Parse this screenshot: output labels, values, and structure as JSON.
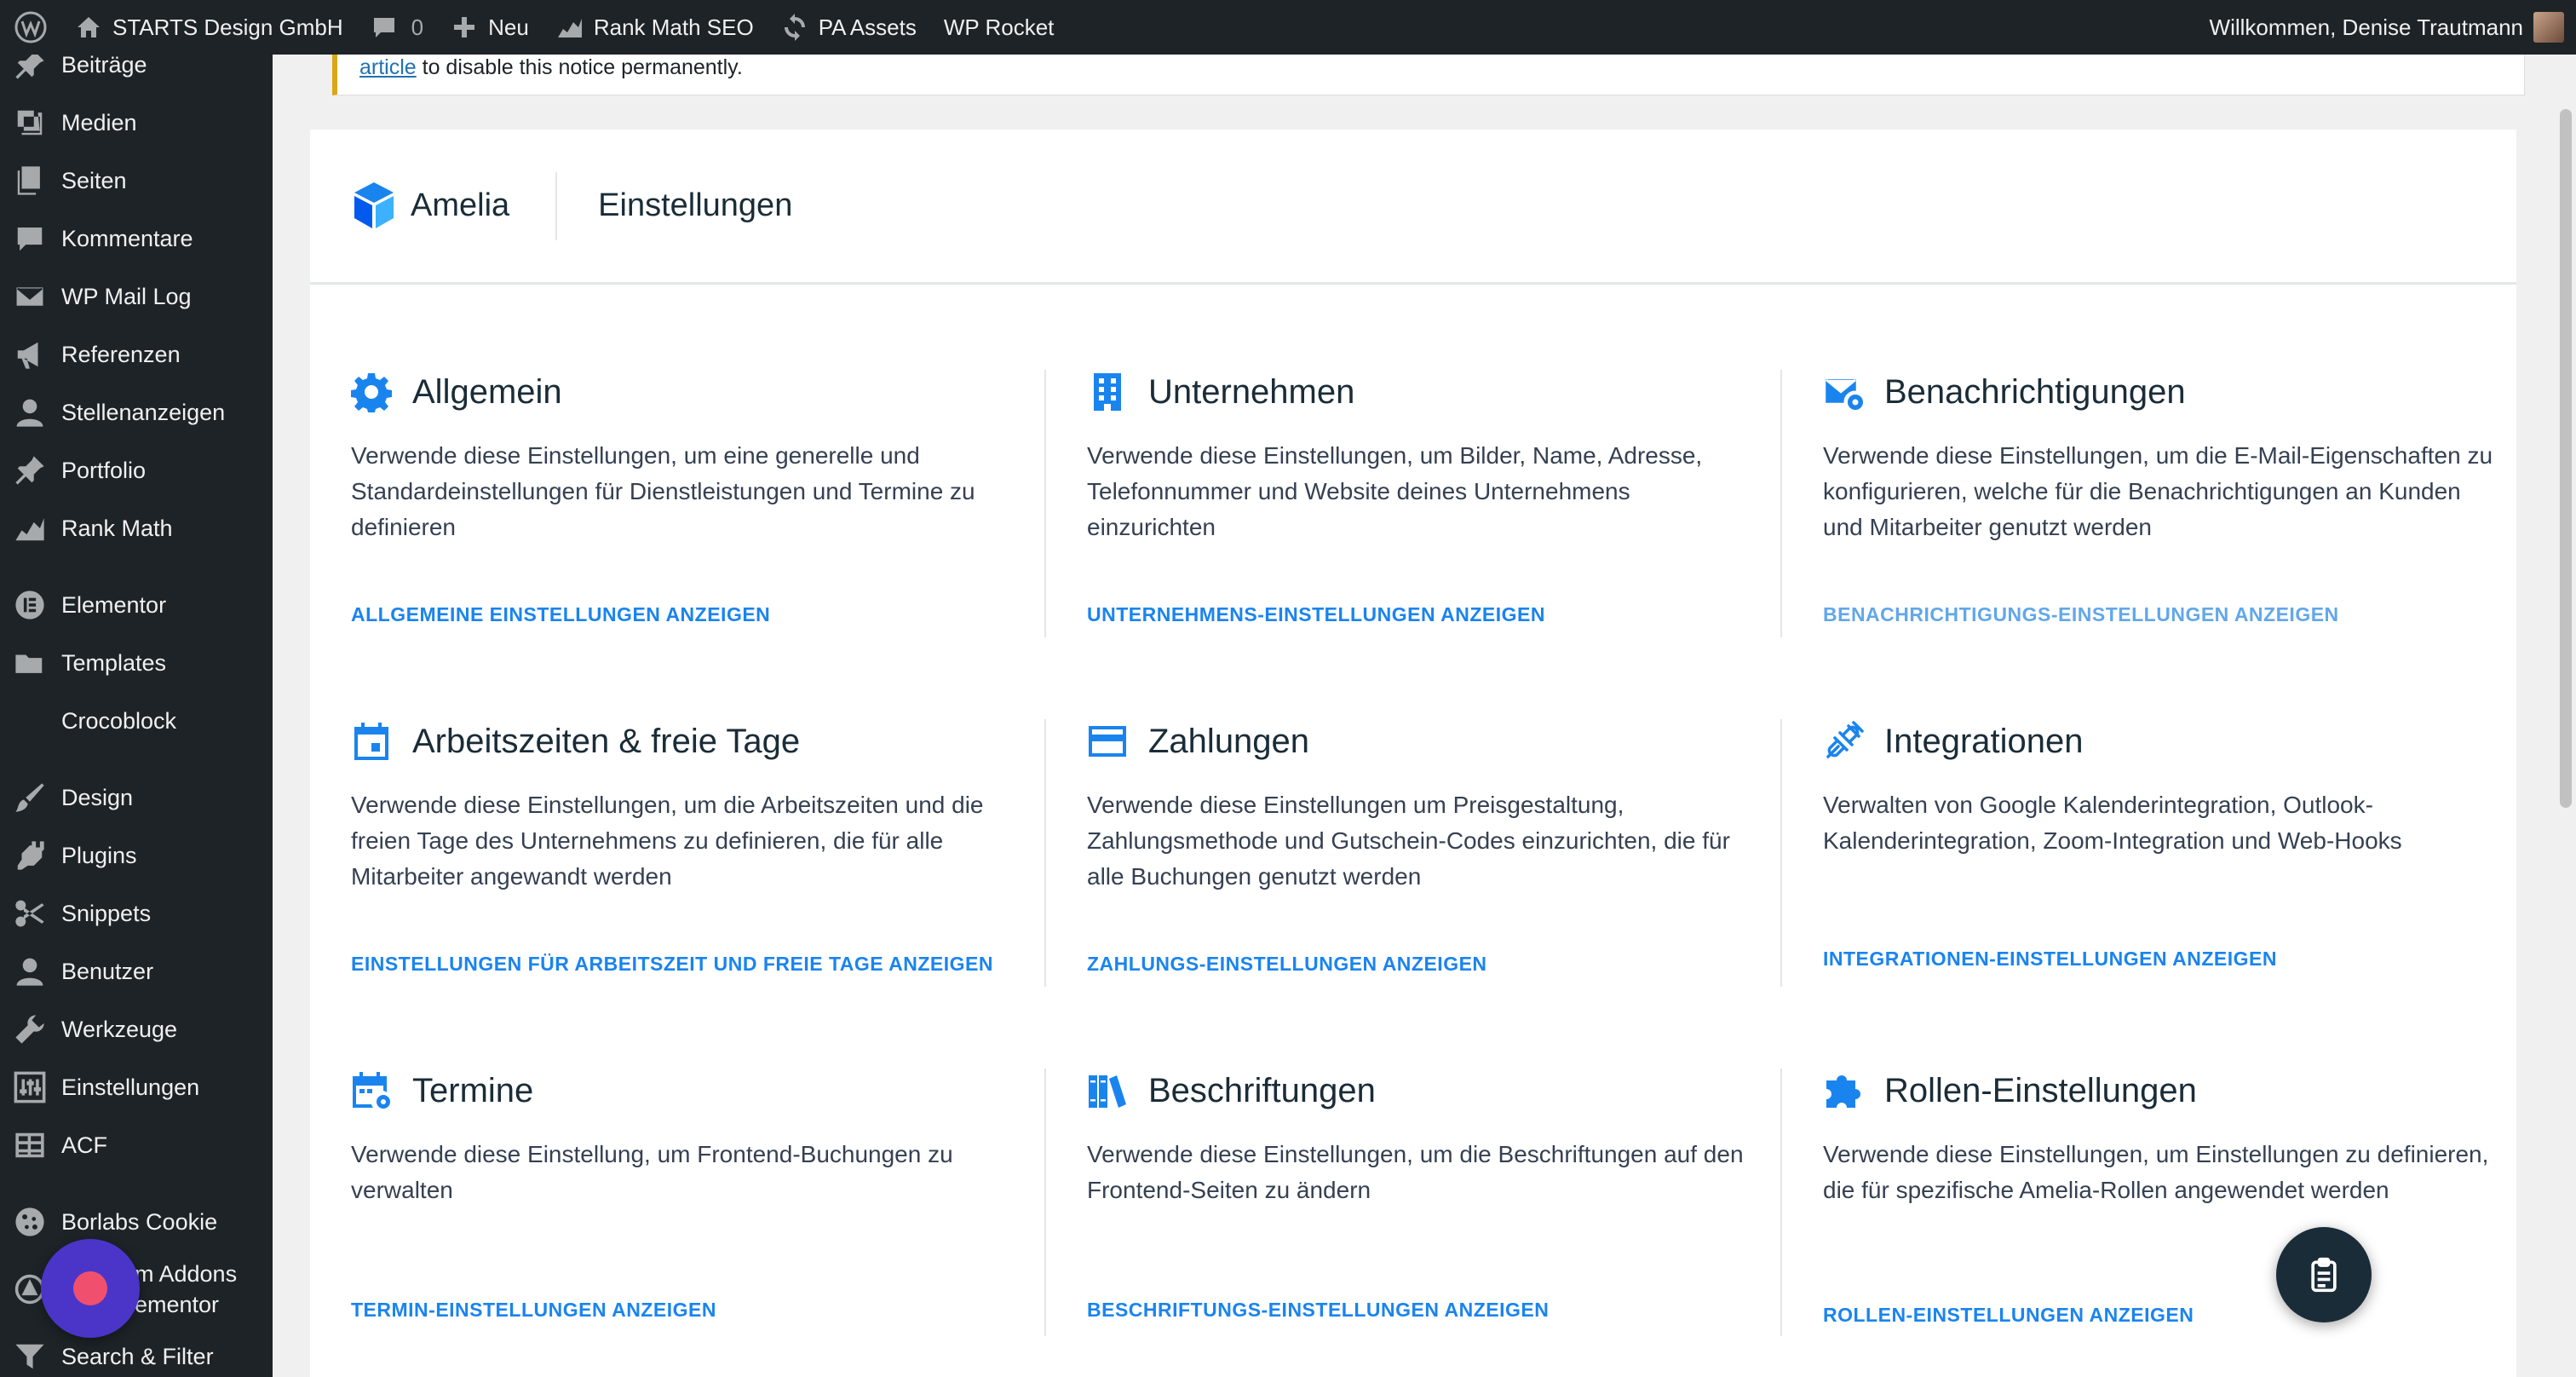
{
  "adminbar": {
    "site_name": "STARTS Design GmbH",
    "comments_count": "0",
    "new_label": "Neu",
    "rankmath_label": "Rank Math SEO",
    "pa_assets_label": "PA Assets",
    "wp_rocket_label": "WP Rocket",
    "greeting": "Willkommen, Denise Trautmann"
  },
  "sidebar": {
    "items": [
      {
        "label": "Beiträge",
        "icon": "pin-icon"
      },
      {
        "label": "Medien",
        "icon": "media-icon"
      },
      {
        "label": "Seiten",
        "icon": "pages-icon"
      },
      {
        "label": "Kommentare",
        "icon": "comment-icon"
      },
      {
        "label": "WP Mail Log",
        "icon": "mail-icon"
      },
      {
        "label": "Referenzen",
        "icon": "megaphone-icon"
      },
      {
        "label": "Stellenanzeigen",
        "icon": "user-icon"
      },
      {
        "label": "Portfolio",
        "icon": "pin-icon"
      },
      {
        "label": "Rank Math",
        "icon": "chart-icon"
      },
      {
        "label": "Elementor",
        "icon": "elementor-icon"
      },
      {
        "label": "Templates",
        "icon": "folder-icon"
      },
      {
        "label": "Crocoblock",
        "icon": "crocoblock-icon"
      },
      {
        "label": "Design",
        "icon": "brush-icon"
      },
      {
        "label": "Plugins",
        "icon": "plugin-icon"
      },
      {
        "label": "Snippets",
        "icon": "scissors-icon"
      },
      {
        "label": "Benutzer",
        "icon": "user-icon"
      },
      {
        "label": "Werkzeuge",
        "icon": "wrench-icon"
      },
      {
        "label": "Einstellungen",
        "icon": "settings-icon"
      },
      {
        "label": "ACF",
        "icon": "grid-icon"
      },
      {
        "label": "Borlabs Cookie",
        "icon": "cookie-icon"
      },
      {
        "label": "Premium Addons for Elementor",
        "label_visible_line1": "m Addons",
        "label_visible_line2": "ementor",
        "icon": "addons-icon"
      },
      {
        "label": "Search & Filter",
        "icon": "filter-icon"
      }
    ]
  },
  "notice": {
    "link_text": "article",
    "text": " to disable this notice permanently."
  },
  "header": {
    "logo_text": "Amelia",
    "title": "Einstellungen"
  },
  "colors": {
    "accent": "#1a84ee",
    "accent_light": "#62a7ea",
    "adminbar_bg": "#1d2327",
    "title_text": "#1a2c37",
    "body_text": "#354052"
  },
  "cards": [
    {
      "icon": "gear-icon",
      "title": "Allgemein",
      "desc": "Verwende diese Einstellungen, um eine generelle und Standardeinstellungen für Dienstleistungen und Termine zu definieren",
      "link": "ALLGEMEINE EINSTELLUNGEN ANZEIGEN"
    },
    {
      "icon": "building-icon",
      "title": "Unternehmen",
      "desc": "Verwende diese Einstellungen, um Bilder, Name, Adresse, Telefonnummer und Website deines Unternehmens einzurichten",
      "link": "UNTERNEHMENS-EINSTELLUNGEN ANZEIGEN"
    },
    {
      "icon": "mail-settings-icon",
      "title": "Benachrichtigungen",
      "desc": "Verwende diese Einstellungen, um die E-Mail-Eigenschaften zu konfigurieren, welche für die Benachrichtigungen an Kunden und Mitarbeiter genutzt werden",
      "link": "BENACHRICHTIGUNGS-EINSTELLUNGEN ANZEIGEN"
    },
    {
      "icon": "calendar-icon",
      "title": "Arbeitszeiten & freie Tage",
      "desc": "Verwende diese Einstellungen, um die Arbeitszeiten und die freien Tage des Unternehmens zu definieren, die für alle Mitarbeiter angewandt werden",
      "link": "EINSTELLUNGEN FÜR ARBEITSZEIT UND FREIE TAGE ANZEIGEN"
    },
    {
      "icon": "credit-card-icon",
      "title": "Zahlungen",
      "desc": "Verwende diese Einstellungen um Preisgestaltung, Zahlungsmethode und Gutschein-Codes einzurichten, die für alle Buchungen genutzt werden",
      "link": "ZAHLUNGS-EINSTELLUNGEN ANZEIGEN"
    },
    {
      "icon": "plug-icon",
      "title": "Integrationen",
      "desc": "Verwalten von Google Kalenderintegration, Outlook-Kalenderintegration, Zoom-Integration und Web-Hooks",
      "link": "INTEGRATIONEN-EINSTELLUNGEN ANZEIGEN"
    },
    {
      "icon": "calendar-settings-icon",
      "title": "Termine",
      "desc": "Verwende diese Einstellung, um Frontend-Buchungen zu verwalten",
      "link": "TERMIN-EINSTELLUNGEN ANZEIGEN"
    },
    {
      "icon": "books-icon",
      "title": "Beschriftungen",
      "desc": "Verwende diese Einstellungen, um die Beschriftungen auf den Frontend-Seiten zu ändern",
      "link": "BESCHRIFTUNGS-EINSTELLUNGEN ANZEIGEN"
    },
    {
      "icon": "puzzle-icon",
      "title": "Rollen-Einstellungen",
      "desc": "Verwende diese Einstellungen, um Einstellungen zu definieren, die für spezifische Amelia-Rollen angewendet werden",
      "link": "ROLLEN-EINSTELLUNGEN ANZEIGEN"
    }
  ]
}
